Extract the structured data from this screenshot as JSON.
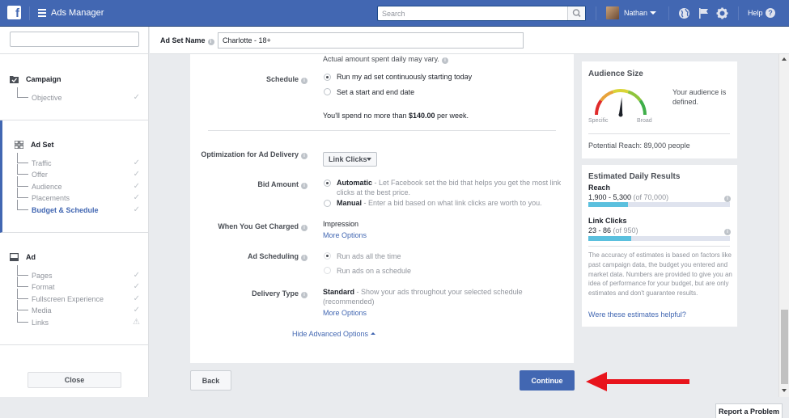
{
  "topbar": {
    "logo": "f",
    "app_title": "Ads Manager",
    "search_placeholder": "Search",
    "username": "Nathan",
    "help": "Help",
    "help_glyph": "?"
  },
  "sidebar": {
    "search_value": "",
    "campaign": {
      "title": "Campaign",
      "items": [
        {
          "label": "Objective",
          "check": "✓"
        }
      ]
    },
    "adset": {
      "title": "Ad Set",
      "items": [
        {
          "label": "Traffic",
          "check": "✓"
        },
        {
          "label": "Offer",
          "check": "✓"
        },
        {
          "label": "Audience",
          "check": "✓"
        },
        {
          "label": "Placements",
          "check": "✓"
        },
        {
          "label": "Budget & Schedule",
          "check": "✓"
        }
      ]
    },
    "ad": {
      "title": "Ad",
      "items": [
        {
          "label": "Pages",
          "check": "✓"
        },
        {
          "label": "Format",
          "check": "✓"
        },
        {
          "label": "Fullscreen Experience",
          "check": "✓"
        },
        {
          "label": "Media",
          "check": "✓"
        },
        {
          "label": "Links",
          "check": "⚠"
        }
      ]
    },
    "close": "Close"
  },
  "adset_bar": {
    "label": "Ad Set Name",
    "value": "Charlotte - 18+"
  },
  "form": {
    "actual_amount_note": "Actual amount spent daily may vary.",
    "schedule": {
      "label": "Schedule",
      "option_continuous": "Run my ad set continuously starting today",
      "option_start_end": "Set a start and end date",
      "spend_prefix": "You'll spend no more than ",
      "spend_amount": "$140.00",
      "spend_suffix": " per week."
    },
    "optimization": {
      "label": "Optimization for Ad Delivery",
      "value": "Link Clicks"
    },
    "bid": {
      "label": "Bid Amount",
      "automatic_title": "Automatic",
      "automatic_desc": " - Let Facebook set the bid that helps you get the most link clicks at the best price.",
      "manual_title": "Manual",
      "manual_desc": " - Enter a bid based on what link clicks are worth to you."
    },
    "charged": {
      "label": "When You Get Charged",
      "value": "Impression",
      "more": "More Options"
    },
    "scheduling": {
      "label": "Ad Scheduling",
      "option_all_time": "Run ads all the time",
      "option_schedule": "Run ads on a schedule"
    },
    "delivery": {
      "label": "Delivery Type",
      "value_title": "Standard",
      "value_desc": " - Show your ads throughout your selected schedule (recommended)",
      "more": "More Options"
    },
    "hide_advanced": "Hide Advanced Options"
  },
  "footer": {
    "back": "Back",
    "continue": "Continue",
    "report": "Report a Problem"
  },
  "audience": {
    "title": "Audience Size",
    "defined_text": "Your audience is defined.",
    "specific": "Specific",
    "broad": "Broad",
    "potential_reach": "Potential Reach: 89,000 people",
    "gauge_level": 0.52
  },
  "estimates": {
    "title": "Estimated Daily Results",
    "reach_label": "Reach",
    "reach_range": "1,900 - 5,300",
    "reach_of": " (of 70,000)",
    "reach_fill": 0.28,
    "clicks_label": "Link Clicks",
    "clicks_range": "23 - 86",
    "clicks_of": " (of 950)",
    "clicks_fill": 0.3,
    "disclaimer": "The accuracy of estimates is based on factors like past campaign data, the budget you entered and market data. Numbers are provided to give you an idea of performance for your budget, but are only estimates and don't guarantee results.",
    "helpful_link": "Were these estimates helpful?"
  },
  "colors": {
    "brand": "#4267b2",
    "annotation_arrow": "#e8141c",
    "bar_fill": "#5bc0de"
  }
}
